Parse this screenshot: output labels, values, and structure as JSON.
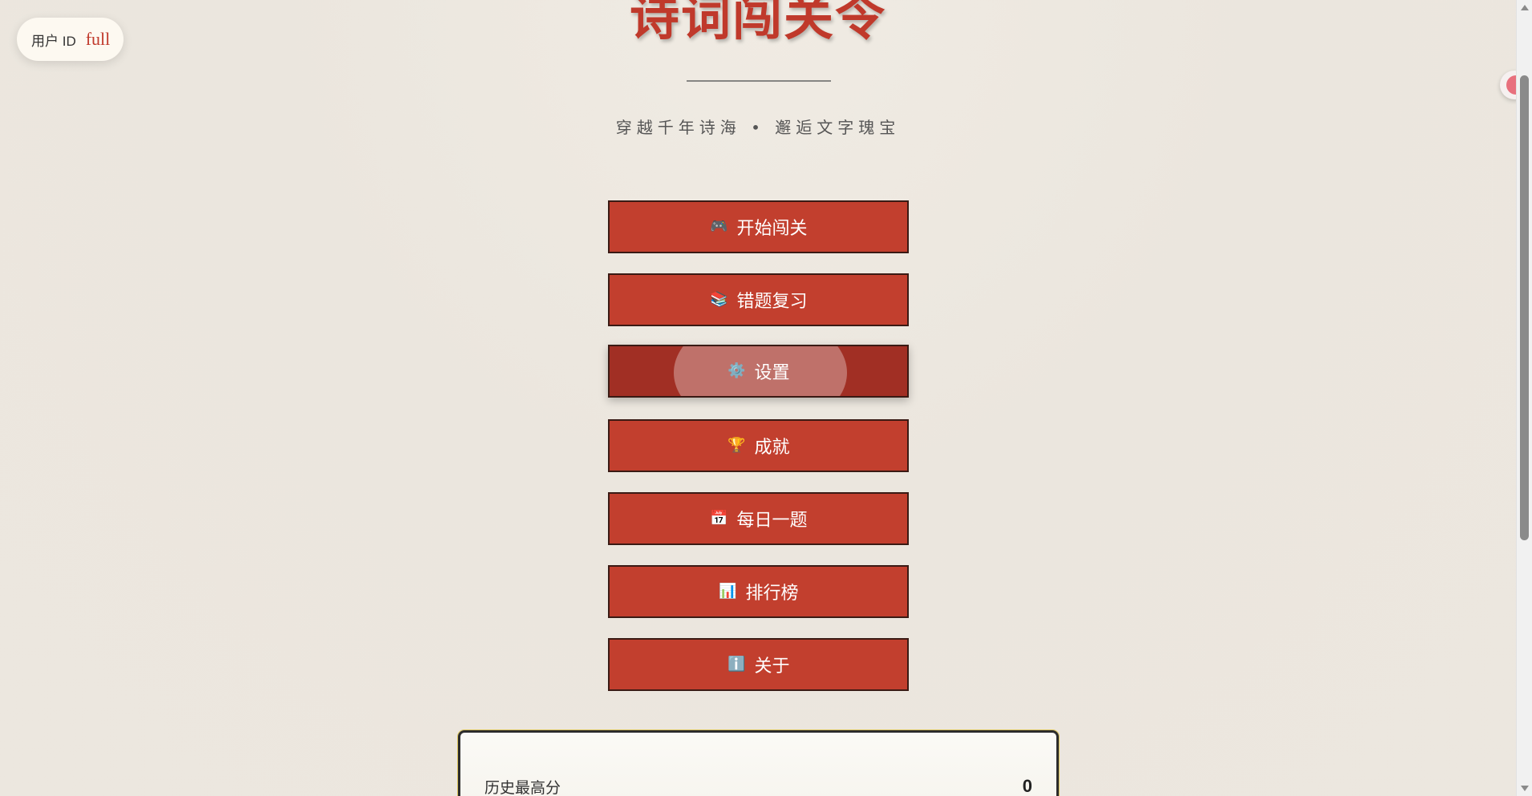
{
  "user": {
    "label": "用户 ID",
    "value": "full"
  },
  "header": {
    "title": "诗词闯关令",
    "subtitle": "穿越千年诗海 • 邂逅文字瑰宝"
  },
  "menu": {
    "items": [
      {
        "label": "开始闯关",
        "icon": "gamepad-icon",
        "glyph": "🎮"
      },
      {
        "label": "错题复习",
        "icon": "books-icon",
        "glyph": "📚"
      },
      {
        "label": "设置",
        "icon": "gear-icon",
        "glyph": "⚙️"
      },
      {
        "label": "成就",
        "icon": "trophy-icon",
        "glyph": "🏆"
      },
      {
        "label": "每日一题",
        "icon": "calendar-icon",
        "glyph": "📅"
      },
      {
        "label": "排行榜",
        "icon": "bar-chart-icon",
        "glyph": "📊"
      },
      {
        "label": "关于",
        "icon": "info-icon",
        "glyph": "ℹ️"
      }
    ],
    "active_index": 2
  },
  "stats": {
    "best_score_label": "历史最高分",
    "best_score_value": "0"
  },
  "colors": {
    "accent": "#c0392b",
    "button": "#c23f2e",
    "button_active": "#a12f24",
    "background": "#ece7df"
  }
}
